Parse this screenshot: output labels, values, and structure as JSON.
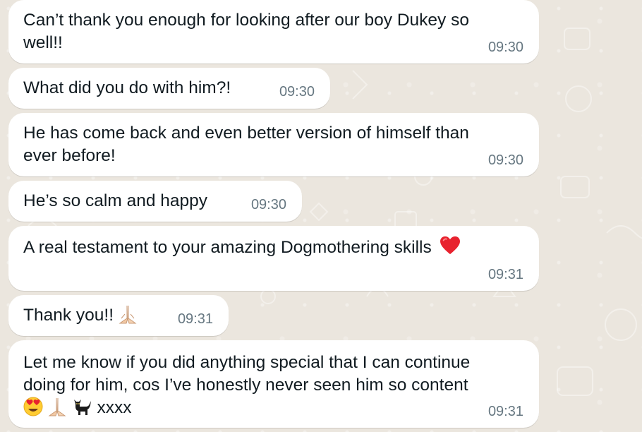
{
  "messages": [
    {
      "line1": "Can’t thank you enough for looking after our boy Dukey so",
      "line2": "well!!",
      "time": "09:30"
    },
    {
      "line1": "What did you do with him?!",
      "time": "09:30"
    },
    {
      "line1": "He has come back and even better version of himself than",
      "line2": "ever before!",
      "time": "09:30"
    },
    {
      "line1": "He’s so calm and happy",
      "time": "09:30"
    },
    {
      "line1": "A real testament to your amazing Dogmothering skills",
      "emoji": "red-heart",
      "time": "09:31"
    },
    {
      "line1": "Thank you!!",
      "emoji": "folded-hands",
      "time": "09:31"
    },
    {
      "line1": "Let me know if you did anything special that I can continue",
      "line2": "doing for him, cos I’ve honestly never seen him so content",
      "line3": "xxxx",
      "emojis": [
        "heart-eyes-face",
        "folded-hands",
        "black-cat"
      ],
      "time": "09:31"
    }
  ],
  "colors": {
    "background": "#ebe6de",
    "bubble": "#ffffff",
    "text": "#111b21",
    "timestamp": "#667781"
  }
}
